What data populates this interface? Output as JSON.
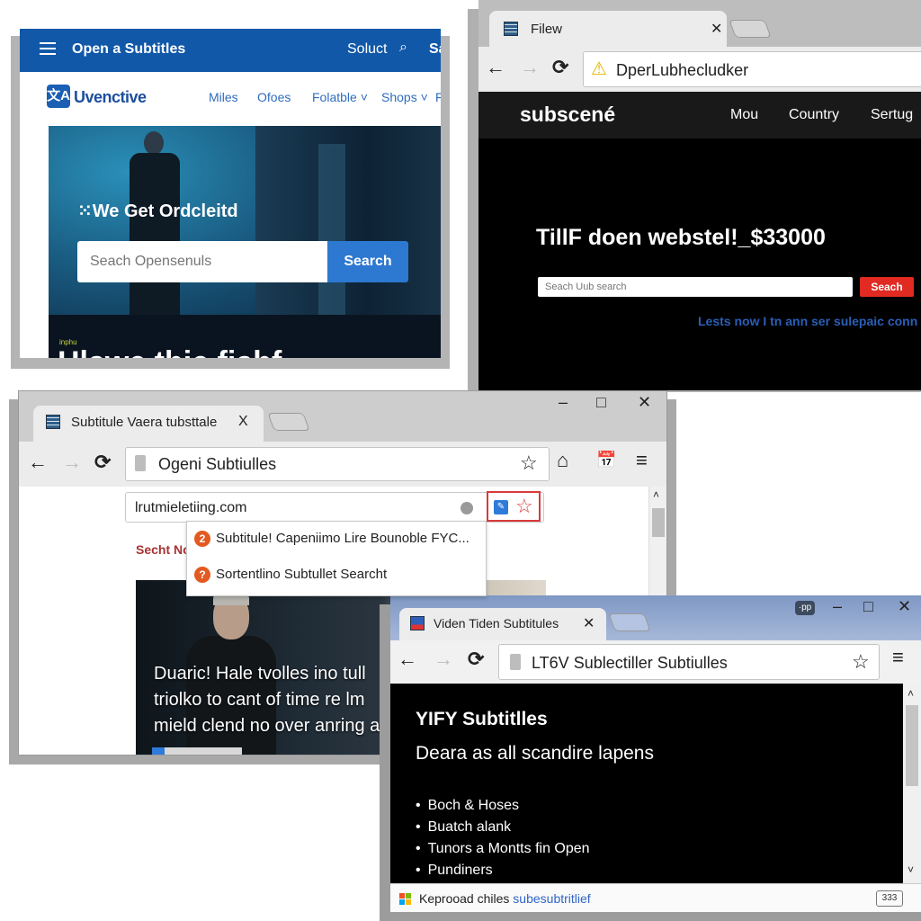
{
  "windows": {
    "opensubtitles": {
      "brand": "Open a Subtitles",
      "topbar_link": "Soluct",
      "topbar_search_icon": "search-icon",
      "topbar_truncated": "Sa",
      "logo_glyph": "文A",
      "logo_text": "Uvenctive",
      "nav": [
        "Miles",
        "Ofoes",
        "Folatble ˅",
        "Shops ˅",
        "F"
      ],
      "hero_title": "⁙We Get Ordcleitd",
      "search_placeholder": "Seach Opensenuls",
      "search_button": "Search",
      "hero_small_text": "inphu",
      "hero_big_text": "Hlawe thie fiahf"
    },
    "subscene": {
      "tab_title": "Filew",
      "tab_close": "✕",
      "back": "←",
      "forward": "→",
      "reload": "⟳",
      "warning_icon": "⚠",
      "address": "DperLubhecludker",
      "logo": "subscené",
      "nav": [
        "Mou",
        "Country",
        "Sertug"
      ],
      "headline": "TillF doen webstel!_$33000",
      "search_placeholder": "Seach Uub search",
      "search_button": "Seach",
      "link_text": "Lests now I tn ann ser sulepaic conn"
    },
    "subtitle_window": {
      "tab_title": "Subtitule Vaera tubsttale",
      "tab_close": "X",
      "minimize": "–",
      "maximize": "□",
      "close": "✕",
      "back": "←",
      "forward": "→",
      "reload": "⟳",
      "address": "Ogeni Subtiulles",
      "bookmark_icon": "☆",
      "home_icon": "⌂",
      "calendar_icon": "📅",
      "menu_icon": "≡",
      "url_field_value": "lrutmieletiing.com",
      "secht_label": "Secht No",
      "suggestions": [
        {
          "badge": "2",
          "text": "Subtitule! Capeniimo Lire Bounoble FYC..."
        },
        {
          "badge": "?",
          "text": "Sortentlino Subtullet Searcht"
        }
      ],
      "photo_caption": [
        "Duaric! Hale tvolles ino tull",
        "triolko to cant of time re lm",
        "mield clend no over anring as"
      ],
      "scroll_up": "˄"
    },
    "yify": {
      "tab_title": "Viden Tiden Subtitules",
      "tab_close": "✕",
      "ext_badge": "·pp",
      "minimize": "–",
      "maximize": "□",
      "close": "✕",
      "back": "←",
      "forward": "→",
      "reload": "⟳",
      "address": "LT6V Sublectiller Subtiulles",
      "bookmark_icon": "☆",
      "menu_icon": "≡",
      "title": "YIFY Subtitlles",
      "subtitle": "Deara as all scandire lapens",
      "list": [
        "Boch & Hoses",
        "Buatch alank",
        "Tunors a Montts fin Open",
        "Pundiners"
      ],
      "status_text": "Keprooad chiles ",
      "status_link": "subesubtritlief",
      "status_icon_text": "333",
      "scroll_up": "˄",
      "scroll_down": "˅"
    }
  },
  "colors": {
    "opensubtitles_blue": "#1258a9",
    "search_button_blue": "#2d78d0",
    "subscene_red": "#e02a22",
    "highlight_red": "#d93a3a",
    "suggestion_orange": "#e25a22",
    "yify_tabstrip": "#8fa6cf"
  }
}
